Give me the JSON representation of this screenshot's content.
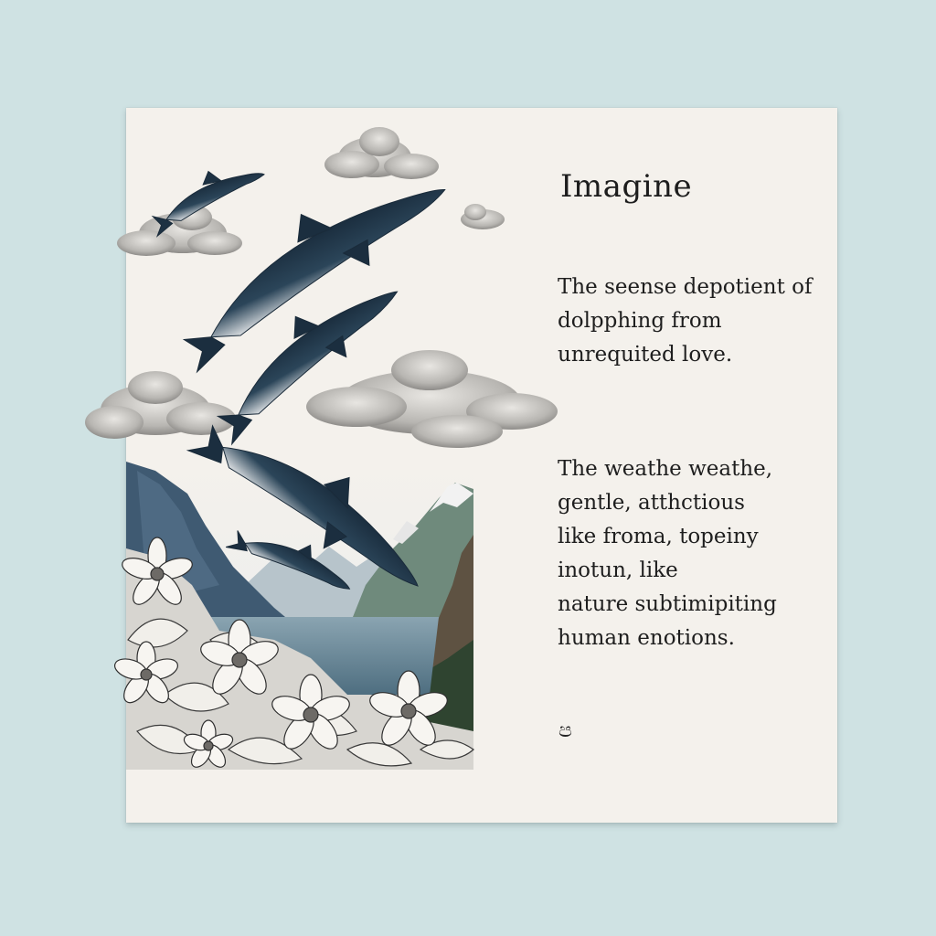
{
  "poem": {
    "title": "Imagine",
    "stanza1": "The seense depotient of\ndolpphing from\nunrequited love.",
    "stanza2": "The weathe weathe,\ngentle, atthctious\nlike froma, topeiny\ninotun, like\nnature subtimipiting\nhuman enotions.",
    "ornament": "ප"
  },
  "colors": {
    "background": "#cfe2e3",
    "paper": "#f4f1ec",
    "dolphin": "#22384a",
    "water": "#5f7f8f"
  },
  "illustration": {
    "subjects": [
      "dolphin",
      "cloud",
      "mountain",
      "lake",
      "flower"
    ]
  }
}
